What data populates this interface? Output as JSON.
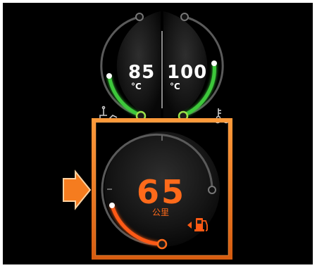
{
  "gauges": {
    "oil_temp": {
      "value": "85",
      "unit": "°C",
      "level": 0.35,
      "icon": "oil-temperature-icon"
    },
    "coolant_temp": {
      "value": "100",
      "unit": "°C",
      "level": 0.5,
      "icon": "coolant-temperature-icon"
    },
    "range": {
      "value": "65",
      "unit": "公里",
      "level": 0.2,
      "icon": "fuel-pump-icon",
      "warning_icon": "low-fuel-arrow-icon"
    }
  },
  "colors": {
    "background": "#000000",
    "green_arc": "#3ec83a",
    "orange_arc": "#ff5a14",
    "highlight_frame": "#f07a1e",
    "pointer_arrow": "#f57c1f",
    "track": "#3a3a3a"
  },
  "selection_indicator": {
    "icon": "pointer-arrow-icon"
  }
}
